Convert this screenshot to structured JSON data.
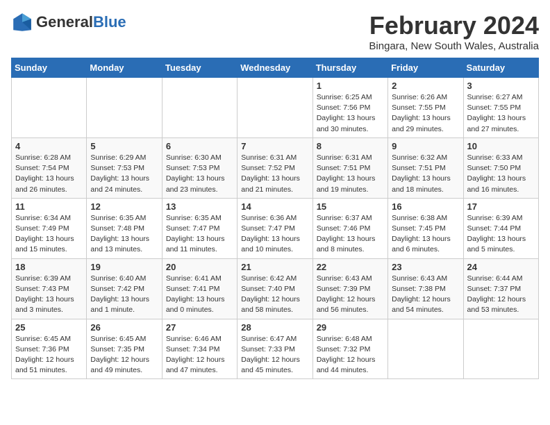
{
  "logo": {
    "text_general": "General",
    "text_blue": "Blue"
  },
  "title": "February 2024",
  "subtitle": "Bingara, New South Wales, Australia",
  "days_of_week": [
    "Sunday",
    "Monday",
    "Tuesday",
    "Wednesday",
    "Thursday",
    "Friday",
    "Saturday"
  ],
  "weeks": [
    [
      {
        "day": "",
        "info": ""
      },
      {
        "day": "",
        "info": ""
      },
      {
        "day": "",
        "info": ""
      },
      {
        "day": "",
        "info": ""
      },
      {
        "day": "1",
        "info": "Sunrise: 6:25 AM\nSunset: 7:56 PM\nDaylight: 13 hours\nand 30 minutes."
      },
      {
        "day": "2",
        "info": "Sunrise: 6:26 AM\nSunset: 7:55 PM\nDaylight: 13 hours\nand 29 minutes."
      },
      {
        "day": "3",
        "info": "Sunrise: 6:27 AM\nSunset: 7:55 PM\nDaylight: 13 hours\nand 27 minutes."
      }
    ],
    [
      {
        "day": "4",
        "info": "Sunrise: 6:28 AM\nSunset: 7:54 PM\nDaylight: 13 hours\nand 26 minutes."
      },
      {
        "day": "5",
        "info": "Sunrise: 6:29 AM\nSunset: 7:53 PM\nDaylight: 13 hours\nand 24 minutes."
      },
      {
        "day": "6",
        "info": "Sunrise: 6:30 AM\nSunset: 7:53 PM\nDaylight: 13 hours\nand 23 minutes."
      },
      {
        "day": "7",
        "info": "Sunrise: 6:31 AM\nSunset: 7:52 PM\nDaylight: 13 hours\nand 21 minutes."
      },
      {
        "day": "8",
        "info": "Sunrise: 6:31 AM\nSunset: 7:51 PM\nDaylight: 13 hours\nand 19 minutes."
      },
      {
        "day": "9",
        "info": "Sunrise: 6:32 AM\nSunset: 7:51 PM\nDaylight: 13 hours\nand 18 minutes."
      },
      {
        "day": "10",
        "info": "Sunrise: 6:33 AM\nSunset: 7:50 PM\nDaylight: 13 hours\nand 16 minutes."
      }
    ],
    [
      {
        "day": "11",
        "info": "Sunrise: 6:34 AM\nSunset: 7:49 PM\nDaylight: 13 hours\nand 15 minutes."
      },
      {
        "day": "12",
        "info": "Sunrise: 6:35 AM\nSunset: 7:48 PM\nDaylight: 13 hours\nand 13 minutes."
      },
      {
        "day": "13",
        "info": "Sunrise: 6:35 AM\nSunset: 7:47 PM\nDaylight: 13 hours\nand 11 minutes."
      },
      {
        "day": "14",
        "info": "Sunrise: 6:36 AM\nSunset: 7:47 PM\nDaylight: 13 hours\nand 10 minutes."
      },
      {
        "day": "15",
        "info": "Sunrise: 6:37 AM\nSunset: 7:46 PM\nDaylight: 13 hours\nand 8 minutes."
      },
      {
        "day": "16",
        "info": "Sunrise: 6:38 AM\nSunset: 7:45 PM\nDaylight: 13 hours\nand 6 minutes."
      },
      {
        "day": "17",
        "info": "Sunrise: 6:39 AM\nSunset: 7:44 PM\nDaylight: 13 hours\nand 5 minutes."
      }
    ],
    [
      {
        "day": "18",
        "info": "Sunrise: 6:39 AM\nSunset: 7:43 PM\nDaylight: 13 hours\nand 3 minutes."
      },
      {
        "day": "19",
        "info": "Sunrise: 6:40 AM\nSunset: 7:42 PM\nDaylight: 13 hours\nand 1 minute."
      },
      {
        "day": "20",
        "info": "Sunrise: 6:41 AM\nSunset: 7:41 PM\nDaylight: 13 hours\nand 0 minutes."
      },
      {
        "day": "21",
        "info": "Sunrise: 6:42 AM\nSunset: 7:40 PM\nDaylight: 12 hours\nand 58 minutes."
      },
      {
        "day": "22",
        "info": "Sunrise: 6:43 AM\nSunset: 7:39 PM\nDaylight: 12 hours\nand 56 minutes."
      },
      {
        "day": "23",
        "info": "Sunrise: 6:43 AM\nSunset: 7:38 PM\nDaylight: 12 hours\nand 54 minutes."
      },
      {
        "day": "24",
        "info": "Sunrise: 6:44 AM\nSunset: 7:37 PM\nDaylight: 12 hours\nand 53 minutes."
      }
    ],
    [
      {
        "day": "25",
        "info": "Sunrise: 6:45 AM\nSunset: 7:36 PM\nDaylight: 12 hours\nand 51 minutes."
      },
      {
        "day": "26",
        "info": "Sunrise: 6:45 AM\nSunset: 7:35 PM\nDaylight: 12 hours\nand 49 minutes."
      },
      {
        "day": "27",
        "info": "Sunrise: 6:46 AM\nSunset: 7:34 PM\nDaylight: 12 hours\nand 47 minutes."
      },
      {
        "day": "28",
        "info": "Sunrise: 6:47 AM\nSunset: 7:33 PM\nDaylight: 12 hours\nand 45 minutes."
      },
      {
        "day": "29",
        "info": "Sunrise: 6:48 AM\nSunset: 7:32 PM\nDaylight: 12 hours\nand 44 minutes."
      },
      {
        "day": "",
        "info": ""
      },
      {
        "day": "",
        "info": ""
      }
    ]
  ]
}
